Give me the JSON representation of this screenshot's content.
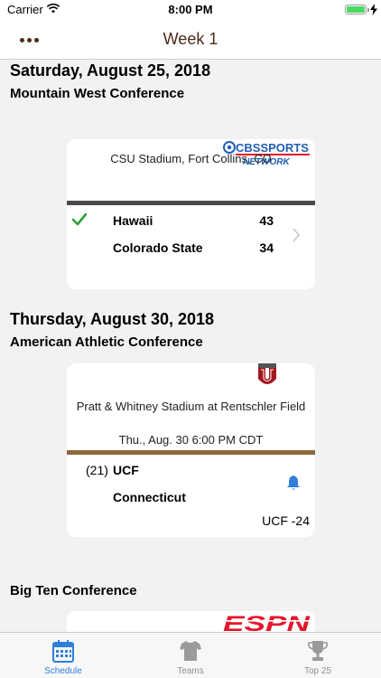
{
  "status_bar": {
    "carrier": "Carrier",
    "time": "8:00 PM"
  },
  "nav": {
    "title": "Week 1",
    "more_icon": "ellipsis-icon"
  },
  "sections": [
    {
      "date": "Saturday, August 25, 2018",
      "conference": "Mountain West Conference",
      "game": {
        "network": "CBS SPORTS NETWORK",
        "venue": "CSU Stadium, Fort Collins, CO",
        "divider_color": "#4a4a4a",
        "teams": [
          {
            "name": "Hawaii",
            "score": "43",
            "winner": true
          },
          {
            "name": "Colorado State",
            "score": "34",
            "winner": false
          }
        ]
      }
    },
    {
      "date": "Thursday, August 30, 2018",
      "conference": "American Athletic Conference",
      "game": {
        "network": "ESPNU",
        "venue": "Pratt & Whitney Stadium at Rentschler Field",
        "time": "Thu., Aug. 30 6:00 PM CDT",
        "divider_color": "#8b6a3e",
        "teams": [
          {
            "rank": "(21)",
            "name": "UCF"
          },
          {
            "name": "Connecticut"
          }
        ],
        "spread": "UCF -24"
      }
    },
    {
      "conference": "Big Ten Conference",
      "game": {
        "network": "ESPN"
      }
    }
  ],
  "tabs": [
    {
      "label": "Schedule",
      "icon": "calendar-icon",
      "active": true
    },
    {
      "label": "Teams",
      "icon": "jersey-icon",
      "active": false
    },
    {
      "label": "Top 25",
      "icon": "trophy-icon",
      "active": false
    }
  ],
  "colors": {
    "accent": "#2f7fd8",
    "nav_text": "#4a2a1a",
    "win_check": "#2e9e3a",
    "cbs_blue": "#1f5fb4",
    "espn_red": "#e3162c",
    "ucf_maroon": "#a3191f"
  }
}
